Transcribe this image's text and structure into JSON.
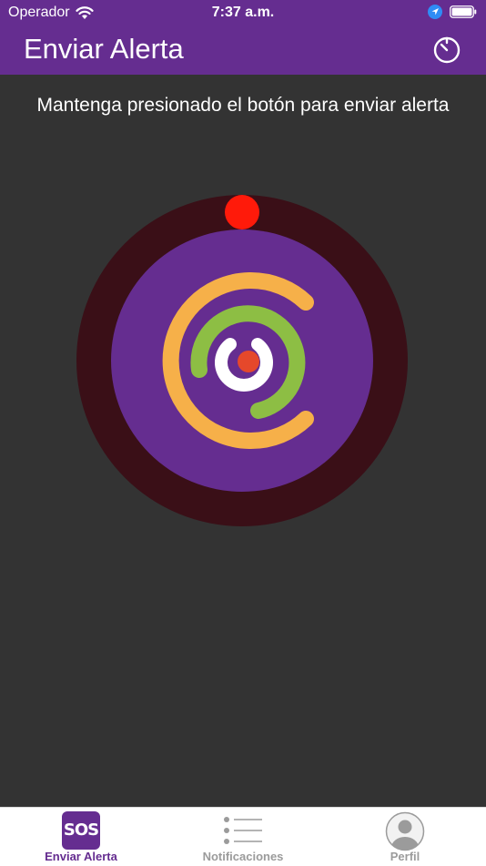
{
  "status_bar": {
    "carrier": "Operador",
    "time": "7:37 a.m."
  },
  "nav": {
    "title": "Enviar Alerta",
    "action_icon": "timer-icon"
  },
  "main": {
    "instruction": "Mantenga presionado el botón para enviar alerta"
  },
  "sos_button": {
    "progress": 0
  },
  "tabs": [
    {
      "label": "Enviar Alerta",
      "icon_text": "SOS",
      "icon": "sos-icon",
      "active": true
    },
    {
      "label": "Notificaciones",
      "icon": "list-icon",
      "active": false
    },
    {
      "label": "Perfil",
      "icon": "profile-icon",
      "active": false
    }
  ],
  "colors": {
    "brand": "#652D90",
    "background": "#333333",
    "outer_ring": "#3A0F17",
    "orange_arc": "#F6B049",
    "green_arc": "#8DBE44",
    "indicator": "#FF1A0A",
    "center_dot": "#E5482B",
    "tab_inactive": "#9B9B9B"
  }
}
